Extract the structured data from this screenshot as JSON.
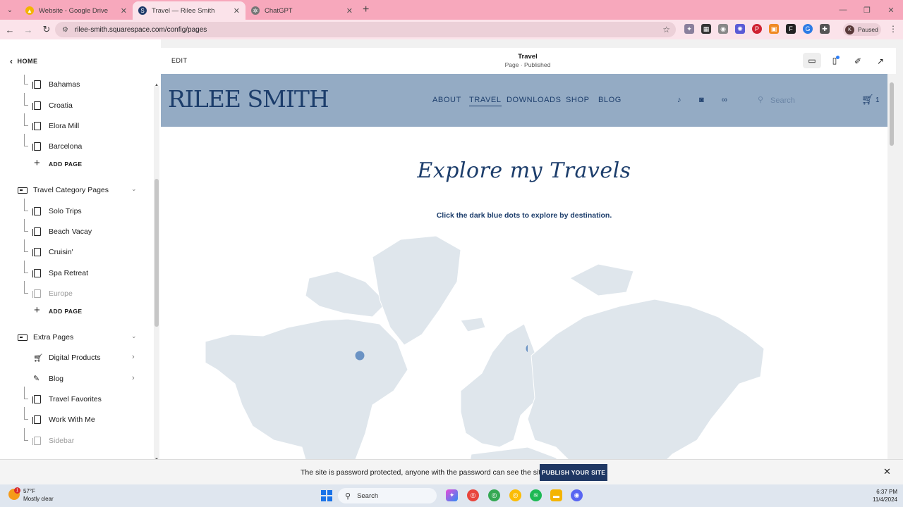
{
  "browser": {
    "tabs": [
      {
        "title": "Website - Google Drive",
        "close": "✕",
        "icon": "google-drive-icon",
        "color": "#f3b400"
      },
      {
        "title": "Travel — Rilee Smith",
        "close": "✕",
        "icon": "squarespace-icon",
        "color": "#1f3b6a"
      },
      {
        "title": "ChatGPT",
        "close": "✕",
        "icon": "chatgpt-icon",
        "color": "#777777"
      }
    ],
    "new_tab": "+",
    "url": "rilee-smith.squarespace.com/config/pages",
    "profile_initial": "K",
    "profile_status": "Paused"
  },
  "sidebar": {
    "home": "HOME",
    "items": [
      {
        "label": "Bahamas"
      },
      {
        "label": "Croatia"
      },
      {
        "label": "Elora Mill"
      },
      {
        "label": "Barcelona"
      },
      {
        "label": "ADD PAGE"
      },
      {
        "label": "Travel Category Pages"
      },
      {
        "label": "Solo Trips"
      },
      {
        "label": "Beach Vacay"
      },
      {
        "label": "Cruisin'"
      },
      {
        "label": "Spa Retreat"
      },
      {
        "label": "Europe"
      },
      {
        "label": "ADD PAGE"
      },
      {
        "label": "Extra Pages"
      },
      {
        "label": "Digital Products"
      },
      {
        "label": "Blog"
      },
      {
        "label": "Travel Favorites"
      },
      {
        "label": "Work With Me"
      },
      {
        "label": "Sidebar"
      }
    ]
  },
  "editor": {
    "edit": "EDIT",
    "page_title": "Travel",
    "page_status": "Page · Published"
  },
  "site": {
    "logo": "RILEE SMITH",
    "nav": [
      "ABOUT",
      "TRAVEL",
      "DOWNLOADS",
      "SHOP",
      "BLOG"
    ],
    "search_placeholder": "Search",
    "cart_count": "1",
    "hero_title": "Explore my Travels",
    "hero_subtitle": "Click the dark blue dots to explore by destination.",
    "header_color": "#94abc4",
    "accent_color": "#1c3d6b",
    "marker_color": "#6b93c4"
  },
  "banner": {
    "text": "The site is password protected, anyone with the password can see the site.",
    "button": "PUBLISH YOUR SITE"
  },
  "taskbar": {
    "temperature": "57°F",
    "condition": "Mostly clear",
    "weather_badge": "1",
    "search": "Search",
    "time": "6:37 PM",
    "date": "11/4/2024"
  }
}
